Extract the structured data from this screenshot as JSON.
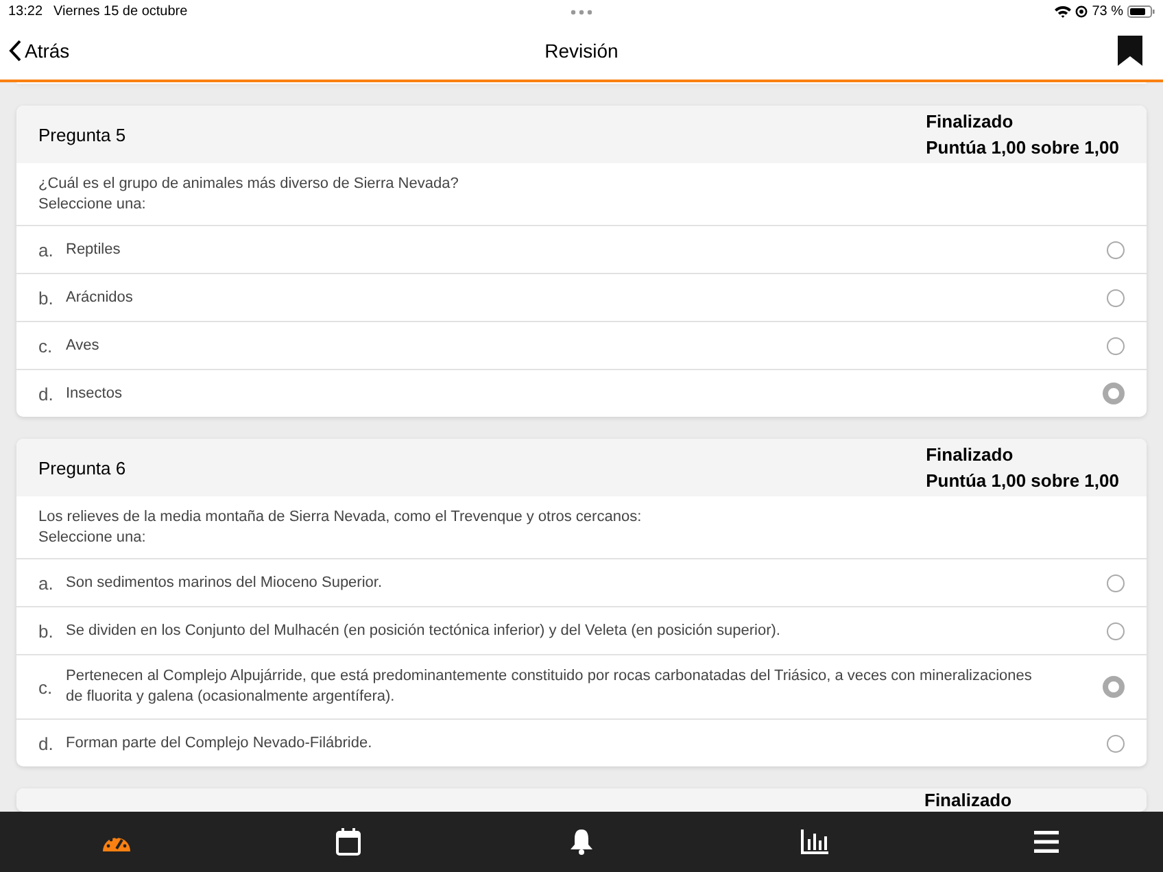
{
  "status_bar": {
    "time": "13:22",
    "date": "Viernes 15 de octubre",
    "battery": "73 %"
  },
  "nav": {
    "back": "Atrás",
    "title": "Revisión"
  },
  "questions": [
    {
      "title": "Pregunta 5",
      "state": "Finalizado",
      "grade": "Puntúa 1,00 sobre 1,00",
      "text": "¿Cuál es el grupo de animales más diverso de Sierra Nevada?",
      "prompt": "Seleccione una:",
      "answers": [
        {
          "letter": "a.",
          "text": "Reptiles",
          "selected": false
        },
        {
          "letter": "b.",
          "text": "Arácnidos",
          "selected": false
        },
        {
          "letter": "c.",
          "text": "Aves",
          "selected": false
        },
        {
          "letter": "d.",
          "text": "Insectos",
          "selected": true
        }
      ]
    },
    {
      "title": "Pregunta 6",
      "state": "Finalizado",
      "grade": "Puntúa 1,00 sobre 1,00",
      "text": "Los relieves de la media montaña de Sierra Nevada, como el Trevenque y otros cercanos:",
      "prompt": "Seleccione una:",
      "answers": [
        {
          "letter": "a.",
          "text": "Son sedimentos marinos del Mioceno Superior.",
          "selected": false
        },
        {
          "letter": "b.",
          "text": "Se dividen en los Conjunto del Mulhacén (en posición tectónica inferior) y del Veleta (en posición superior).",
          "selected": false
        },
        {
          "letter": "c.",
          "text": "Pertenecen al Complejo Alpujárride, que está predominantemente constituido por rocas carbonatadas del Triásico, a veces con mineralizaciones de fluorita y galena (ocasionalmente argentífera).",
          "selected": true
        },
        {
          "letter": "d.",
          "text": "Forman parte del Complejo Nevado-Filábride.",
          "selected": false
        }
      ]
    }
  ],
  "next_card": {
    "state": "Finalizado"
  },
  "tab_bar": [
    {
      "kind": "gauge",
      "selected": true
    },
    {
      "kind": "calendar",
      "selected": false
    },
    {
      "kind": "bell",
      "selected": false
    },
    {
      "kind": "chart",
      "selected": false
    },
    {
      "kind": "menu",
      "selected": false
    }
  ]
}
